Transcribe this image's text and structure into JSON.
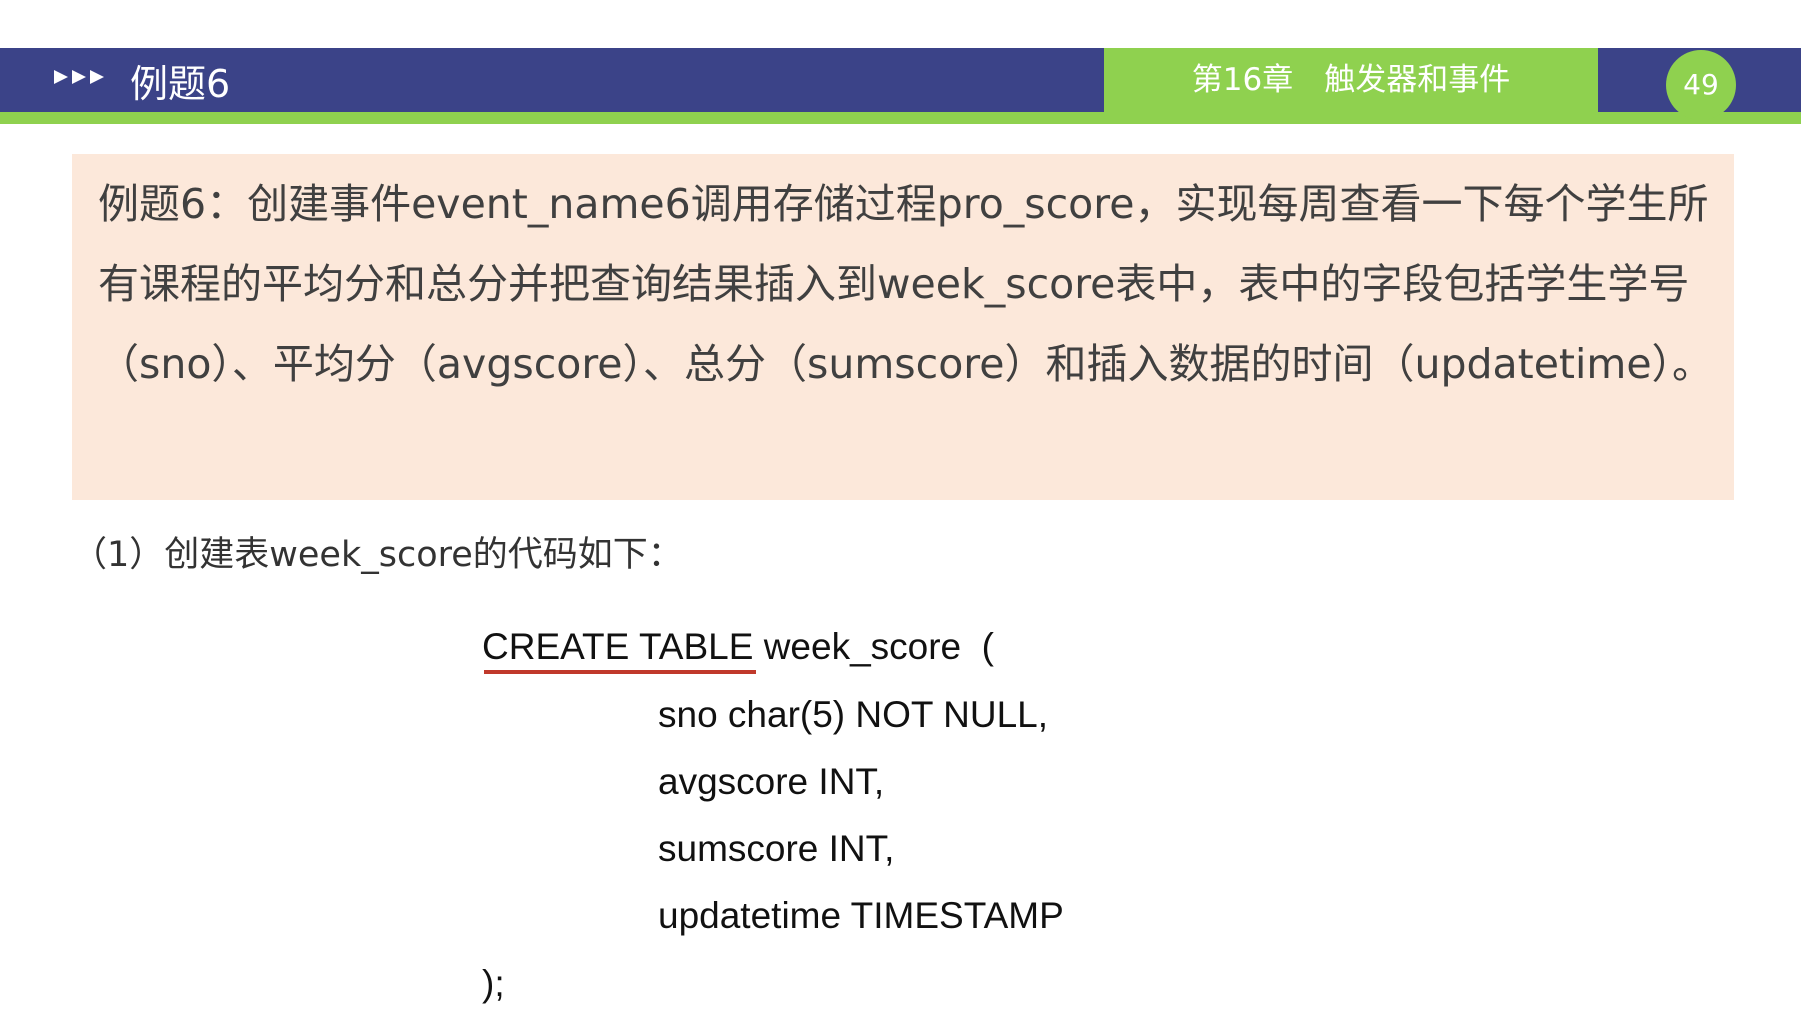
{
  "header": {
    "title": "例题6",
    "chapter": "第16章　触发器和事件",
    "page_number": "49"
  },
  "problem": {
    "text": "例题6：创建事件event_name6调用存储过程pro_score，实现每周查看一下每个学生所有课程的平均分和总分并把查询结果插入到week_score表中，表中的字段包括学生学号（sno）、平均分（avgscore）、总分（sumscore）和插入数据的时间（updatetime）。"
  },
  "step": {
    "label": "（1）创建表week_score的代码如下："
  },
  "code": {
    "line1": "CREATE TABLE week_score  (",
    "line2": "sno char(5) NOT NULL,",
    "line3": "avgscore INT,",
    "line4": "sumscore INT,",
    "line5": "updatetime TIMESTAMP",
    "line6": ");"
  },
  "colors": {
    "header_navy": "#3b4388",
    "accent_green": "#8fd14f",
    "problem_background": "#fce8da",
    "squiggle_red": "#c0392b"
  }
}
